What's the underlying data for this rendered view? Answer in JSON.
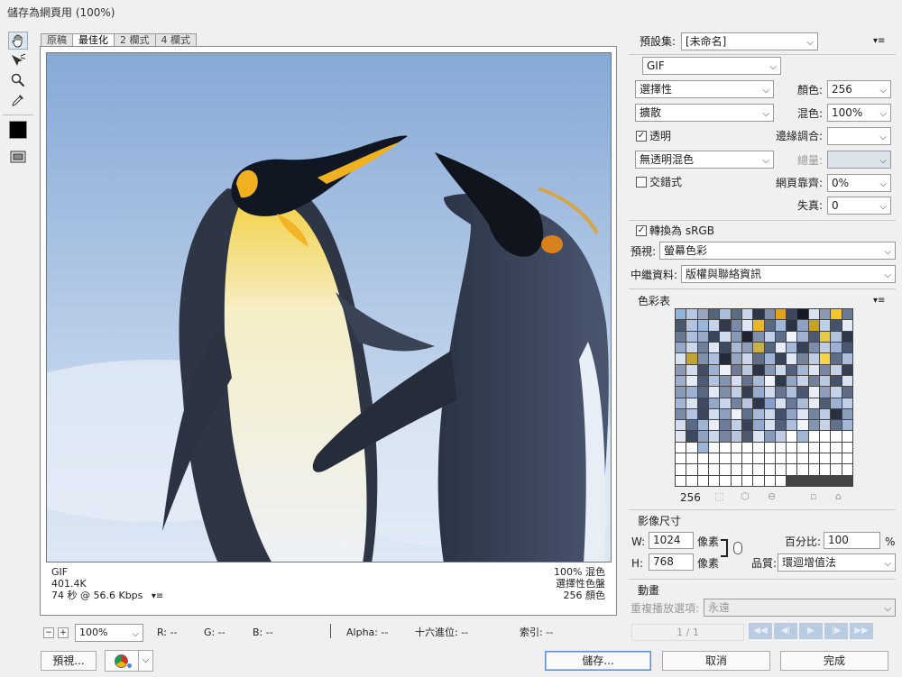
{
  "window": {
    "title": "儲存為網頁用 (100%)"
  },
  "toolbar": {
    "tools": [
      "hand-tool-icon",
      "slice-select-tool-icon",
      "zoom-tool-icon",
      "eyedropper-tool-icon",
      "eyedropper-color-swatch",
      "toggle-slices-icon"
    ],
    "swatch_color": "#000000"
  },
  "view_tabs": [
    "原稿",
    "最佳化",
    "2 欄式",
    "4 欄式"
  ],
  "preview_info": {
    "format": "GIF",
    "size": "401.4K",
    "time": "74 秒 @ 56.6 Kbps",
    "menu": "▾≡",
    "dither": "100% 混色",
    "palette_type": "選擇性色盤",
    "colors": "256 顏色"
  },
  "status_bar": {
    "zoom_minus": "−",
    "zoom_plus": "+",
    "zoom": "100%",
    "r": "R: --",
    "g": "G: --",
    "b": "B: --",
    "alpha": "Alpha: --",
    "hex": "十六進位: --",
    "index": "索引: --"
  },
  "bottom_buttons": {
    "preview": "預視...",
    "save": "儲存...",
    "cancel": "取消",
    "done": "完成"
  },
  "settings": {
    "preset_label": "預設集:",
    "preset_value": "[未命名]",
    "format": "GIF",
    "reduction": "選擇性",
    "dither_algo": "擴散",
    "transparency_label": "透明",
    "matte_dither": "無透明混色",
    "interlaced_label": "交錯式",
    "colors_label": "顏色:",
    "colors_value": "256",
    "dither_label": "混色:",
    "dither_value": "100%",
    "matte_label": "邊緣調合:",
    "amount_label": "總量:",
    "web_snap_label": "網頁靠齊:",
    "web_snap_value": "0%",
    "lossy_label": "失真:",
    "lossy_value": "0",
    "convert_srgb_label": "轉換為 sRGB",
    "preview_label": "預視:",
    "preview_value": "螢幕色彩",
    "metadata_label": "中繼資料:",
    "metadata_value": "版權與聯絡資訊"
  },
  "color_table": {
    "title": "色彩表",
    "count": "256",
    "colors": [
      "#8fb3d9",
      "#b7c8e4",
      "#9aa5bc",
      "#56647a",
      "#a9bddc",
      "#5c6b84",
      "#c7d6ec",
      "#2d3546",
      "#7d8ea8",
      "#e2a31b",
      "#3c4660",
      "#141a26",
      "#d7e2f2",
      "#8a99b5",
      "#f4c52a",
      "#6b7b97",
      "#4a566e",
      "#b2c3df",
      "#9cb6da",
      "#c6d3e9",
      "#31394b",
      "#7a8aa6",
      "#dfe7f4",
      "#e9b624",
      "#5a6983",
      "#a3b6d6",
      "#2a3243",
      "#8ea1c2",
      "#c8a21c",
      "#bdd0ea",
      "#47536b",
      "#e6ecf6",
      "#6a7894",
      "#aebfdd",
      "#9aa9c4",
      "#3b455a",
      "#d0dbee",
      "#8799b8",
      "#1d2330",
      "#7f90ae",
      "#c1cee6",
      "#5e6d88",
      "#f1f4fa",
      "#a0b1cf",
      "#4e5a72",
      "#e4ca4a",
      "#b4c2da",
      "#2e3647",
      "#96a8c7",
      "#cbd6ea",
      "#6f7e99",
      "#dfe6f2",
      "#3f4a60",
      "#aab9d4",
      "#8d9dba",
      "#c9b14a",
      "#57657f",
      "#e8edf6",
      "#a7b8d6",
      "#34405a",
      "#7c8ca9",
      "#bfcbe2",
      "#9bb0d2",
      "#4b5770",
      "#d9e2f1",
      "#c2a434",
      "#828fa8",
      "#b0c0dc",
      "#232a38",
      "#95a6c3",
      "#ccd7eb",
      "#606e88",
      "#a1b4d5",
      "#3a4459",
      "#e1e8f5",
      "#748398",
      "#beccE4",
      "#f6d34a",
      "#5f6d87",
      "#adbdd9",
      "#8a9ab6",
      "#d3dced",
      "#434e65",
      "#9eb1d1",
      "#ecf0f7",
      "#6d7b96",
      "#b9c7e0",
      "#2b3344",
      "#8697b5",
      "#cfd9ec",
      "#52607a",
      "#a5b6d3",
      "#dde5f2",
      "#7786a2",
      "#c4d0e6",
      "#393f52",
      "#9caed0",
      "#e5ebf5",
      "#4f5b74",
      "#b3c2dd",
      "#8293b1",
      "#d5deef",
      "#65738e",
      "#a8b9d7",
      "#f0f3f9",
      "#313a4c",
      "#94a5c4",
      "#c9d4e9",
      "#71809b",
      "#bac8e1",
      "#46526a",
      "#dbe3f1",
      "#8899b7",
      "#a0b2d3",
      "#5a6882",
      "#e3e9f4",
      "#7e8ea9",
      "#c0cde4",
      "#363f52",
      "#98aacb",
      "#d1dbed",
      "#677591",
      "#b0bfda",
      "#4c586f",
      "#eaeef6",
      "#8d9ebd",
      "#c6d2e8",
      "#5d6b86",
      "#a4b5d4",
      "#dce4f2",
      "#41495e",
      "#96a7c6",
      "#cad5ea",
      "#72819c",
      "#b8c6e0",
      "#2f3748",
      "#87a0c7",
      "#d8e1f0",
      "#6a7893",
      "#acbcd8",
      "#e7ecf6",
      "#505c75",
      "#9fb1d1",
      "#c3cfe6",
      "#7b8ba7",
      "#b5c4de",
      "#3d475c",
      "#d2dcee",
      "#8fa0bf",
      "#eef2f8",
      "#60708a",
      "#a9bad8",
      "#cdd8eb",
      "#44506a",
      "#93a4c3",
      "#dfe6f3",
      "#74839e",
      "#bccae3",
      "#29313f",
      "#8c9cbb",
      "#d4ddee",
      "#5b6984",
      "#a2b4d4",
      "#e9edf6",
      "#6e7c97",
      "#c1cee5",
      "#37415a",
      "#97a9ca",
      "#d6dfef",
      "#526079",
      "#afbfdb",
      "#f2f5fa",
      "#8495b3",
      "#c7d3e9",
      "#62708b",
      "#a6b7d5",
      "#e0e7f3",
      "#3e485e",
      "#91a2c1",
      "#cbd6ea",
      "#76859f",
      "#b6c5df",
      "#4d596f",
      "#dde4f1",
      "#889ab9",
      "#c0cde5",
      "#ffffff",
      "#a3b5d4",
      "#ffffff",
      "#ffffff",
      "#ffffff",
      "#ffffff",
      "#ffffff",
      "#ffffff",
      "#9bb4dc",
      "#ffffff",
      "#ffffff",
      "#ffffff",
      "#ffffff",
      "#ffffff",
      "#ffffff",
      "#ffffff",
      "#ffffff",
      "#ffffff",
      "#ffffff",
      "#ffffff",
      "#ffffff",
      "#ffffff",
      "#ffffff",
      "#ffffff",
      "#ffffff",
      "#ffffff",
      "#ffffff",
      "#ffffff",
      "#ffffff",
      "#ffffff",
      "#ffffff",
      "#ffffff",
      "#ffffff",
      "#ffffff",
      "#ffffff",
      "#ffffff",
      "#ffffff",
      "#ffffff",
      "#ffffff",
      "#ffffff",
      "#ffffff",
      "#ffffff",
      "#ffffff",
      "#ffffff",
      "#ffffff",
      "#ffffff",
      "#ffffff",
      "#ffffff",
      "#ffffff",
      "#ffffff",
      "#ffffff",
      "#ffffff",
      "#ffffff",
      "#ffffff",
      "#ffffff",
      "#ffffff",
      "#ffffff",
      "#ffffff",
      "#ffffff",
      "#ffffff",
      "#ffffff",
      "#ffffff",
      "#ffffff",
      "#ffffff"
    ]
  },
  "image_size": {
    "title": "影像尺寸",
    "w_label": "W:",
    "w_value": "1024",
    "h_label": "H:",
    "h_value": "768",
    "unit": "像素",
    "percent_label": "百分比:",
    "percent_value": "100",
    "percent_unit": "%",
    "quality_label": "品質:",
    "quality_value": "環迴增值法"
  },
  "animation": {
    "title": "動畫",
    "loop_label": "重複播放選項:",
    "loop_value": "永遠",
    "frame": "1 / 1"
  }
}
